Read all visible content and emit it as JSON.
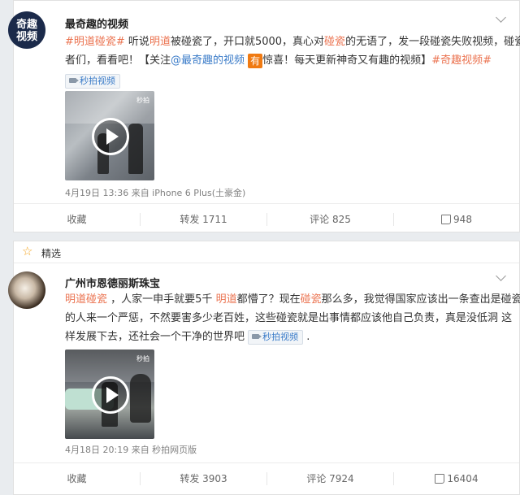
{
  "post1": {
    "avatar_logo": "奇趣\n视频",
    "username": "最奇趣的视频",
    "text_segments": [
      {
        "t": "#明道碰瓷#",
        "c": "link"
      },
      {
        "t": " 听说",
        "c": ""
      },
      {
        "t": "明道",
        "c": "link"
      },
      {
        "t": "被碰瓷了，开口就5000，真心对",
        "c": ""
      },
      {
        "t": "碰瓷",
        "c": "link"
      },
      {
        "t": "的无语了，发一段碰瓷失败视频，碰瓷",
        "c": ""
      }
    ],
    "line2_prefix": "者们，看看吧！【关注",
    "mention": "@最奇趣的视频",
    "you_icon": "有",
    "line2_mid": "惊喜！每天更新神奇又有趣的视频】",
    "hashtag_end": "#奇趣视频#",
    "video_tag": "秒拍视频",
    "video_watermark": "秒拍",
    "meta": "4月19日 13:36 来自 iPhone 6 Plus(土豪金)",
    "actions": {
      "collect": "收藏",
      "repost": "转发 1711",
      "comment": "评论 825",
      "like": "948"
    }
  },
  "featured": {
    "label": "精选"
  },
  "post2": {
    "username": "广州市恩德丽斯珠宝",
    "line1": [
      {
        "t": "明道碰瓷",
        "c": "link"
      },
      {
        "t": " ，人家一申手就要5千 ",
        "c": ""
      },
      {
        "t": "明道",
        "c": "link"
      },
      {
        "t": "都懵了？现在",
        "c": ""
      },
      {
        "t": "碰瓷",
        "c": "link"
      },
      {
        "t": "那么多，我觉得国家应该出一条查出是碰瓷",
        "c": ""
      }
    ],
    "line2": "的人来一个严惩，不然要害多少老百姓，这些碰瓷就是出事情都应该他自己负责，真是没低洞 这",
    "line3": "样发展下去，还社会一个干净的世界吧",
    "line3_end": " .",
    "video_tag": "秒拍视频",
    "video_watermark": "秒拍",
    "meta": "4月18日 20:19 来自 秒拍网页版",
    "actions": {
      "collect": "收藏",
      "repost": "转发 3903",
      "comment": "评论 7924",
      "like": "16404"
    }
  }
}
